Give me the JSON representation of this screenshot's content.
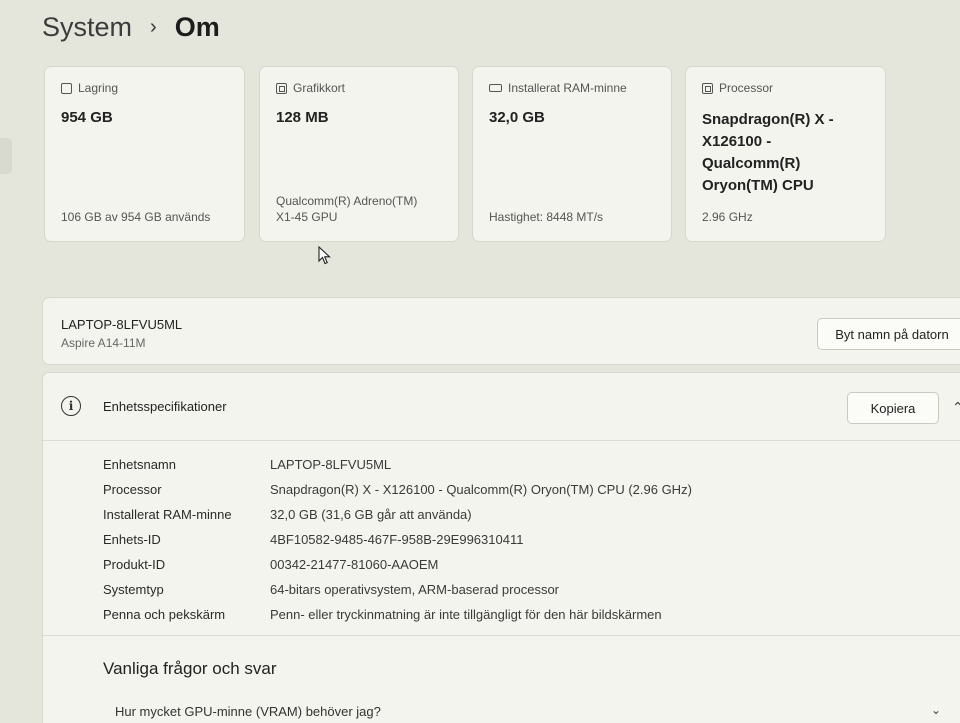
{
  "breadcrumb": {
    "parent": "System",
    "separator": "›",
    "current": "Om"
  },
  "cards": [
    {
      "label": "Lagring",
      "icon": "storage-icon",
      "value": "954 GB",
      "footer": "106 GB av 954 GB används"
    },
    {
      "label": "Grafikkort",
      "icon": "gpu-icon",
      "value": "128 MB",
      "footer": "Qualcomm(R) Adreno(TM) X1-45 GPU"
    },
    {
      "label": "Installerat RAM-minne",
      "icon": "ram-icon",
      "value": "32,0 GB",
      "footer": "Hastighet: 8448 MT/s"
    },
    {
      "label": "Processor",
      "icon": "processor-icon",
      "value": "Snapdragon(R) X - X126100 - Qualcomm(R) Oryon(TM) CPU",
      "footer": "2.96 GHz"
    }
  ],
  "device": {
    "name": "LAPTOP-8LFVU5ML",
    "model": "Aspire A14-11M",
    "rename_label": "Byt namn på datorn"
  },
  "specs": {
    "title": "Enhetsspecifikationer",
    "copy_label": "Kopiera",
    "rows": [
      {
        "label": "Enhetsnamn",
        "value": "LAPTOP-8LFVU5ML"
      },
      {
        "label": "Processor",
        "value": "Snapdragon(R) X - X126100 - Qualcomm(R) Oryon(TM) CPU (2.96 GHz)"
      },
      {
        "label": "Installerat RAM-minne",
        "value": "32,0 GB (31,6 GB går att använda)"
      },
      {
        "label": "Enhets-ID",
        "value": "4BF10582-9485-467F-958B-29E996310411"
      },
      {
        "label": "Produkt-ID",
        "value": "00342-21477-81060-AAOEM"
      },
      {
        "label": "Systemtyp",
        "value": "64-bitars operativsystem, ARM-baserad processor"
      },
      {
        "label": "Penna och pekskärm",
        "value": "Penn- eller tryckinmatning är inte tillgängligt för den här bildskärmen"
      }
    ]
  },
  "faq": {
    "title": "Vanliga frågor och svar",
    "question": "Hur mycket GPU-minne (VRAM) behöver jag?"
  }
}
